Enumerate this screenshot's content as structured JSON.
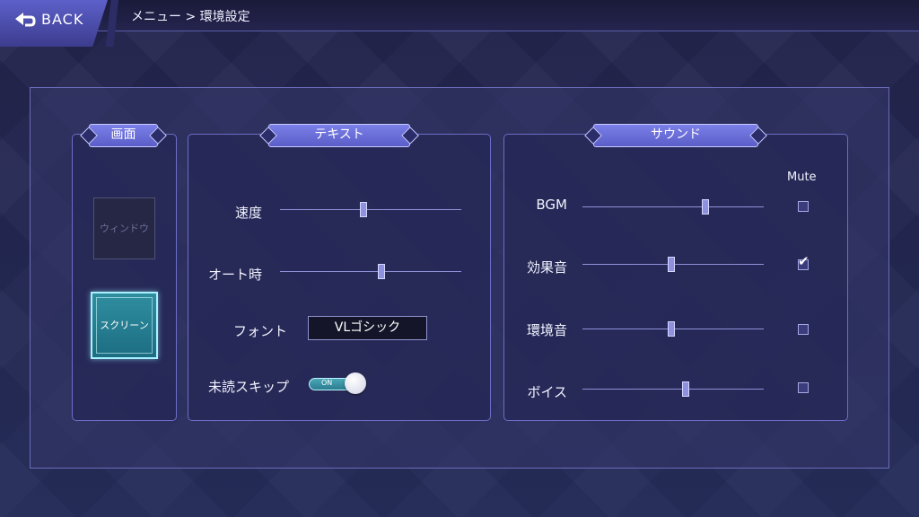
{
  "header": {
    "back_label": "BACK",
    "breadcrumb": "メニュー > 環境設定"
  },
  "screen": {
    "title": "画面",
    "window_label": "ウィンドウ",
    "screen_label": "スクリーン",
    "selected": "スクリーン"
  },
  "text": {
    "title": "テキスト",
    "speed_label": "速度",
    "speed_value": 0.46,
    "auto_label": "オート時",
    "auto_value": 0.56,
    "font_label": "フォント",
    "font_value": "VLゴシック",
    "skip_label": "未読スキップ",
    "skip_state": "ON"
  },
  "sound": {
    "title": "サウンド",
    "mute_label": "Mute",
    "rows": [
      {
        "label": "BGM",
        "value": 0.68,
        "muted": false
      },
      {
        "label": "効果音",
        "value": 0.49,
        "muted": true
      },
      {
        "label": "環境音",
        "value": 0.49,
        "muted": false
      },
      {
        "label": "ボイス",
        "value": 0.57,
        "muted": false
      }
    ]
  },
  "colors": {
    "accent": "#7b7fe8",
    "selected_teal": "#2f8ea0",
    "background": "#23244e"
  }
}
